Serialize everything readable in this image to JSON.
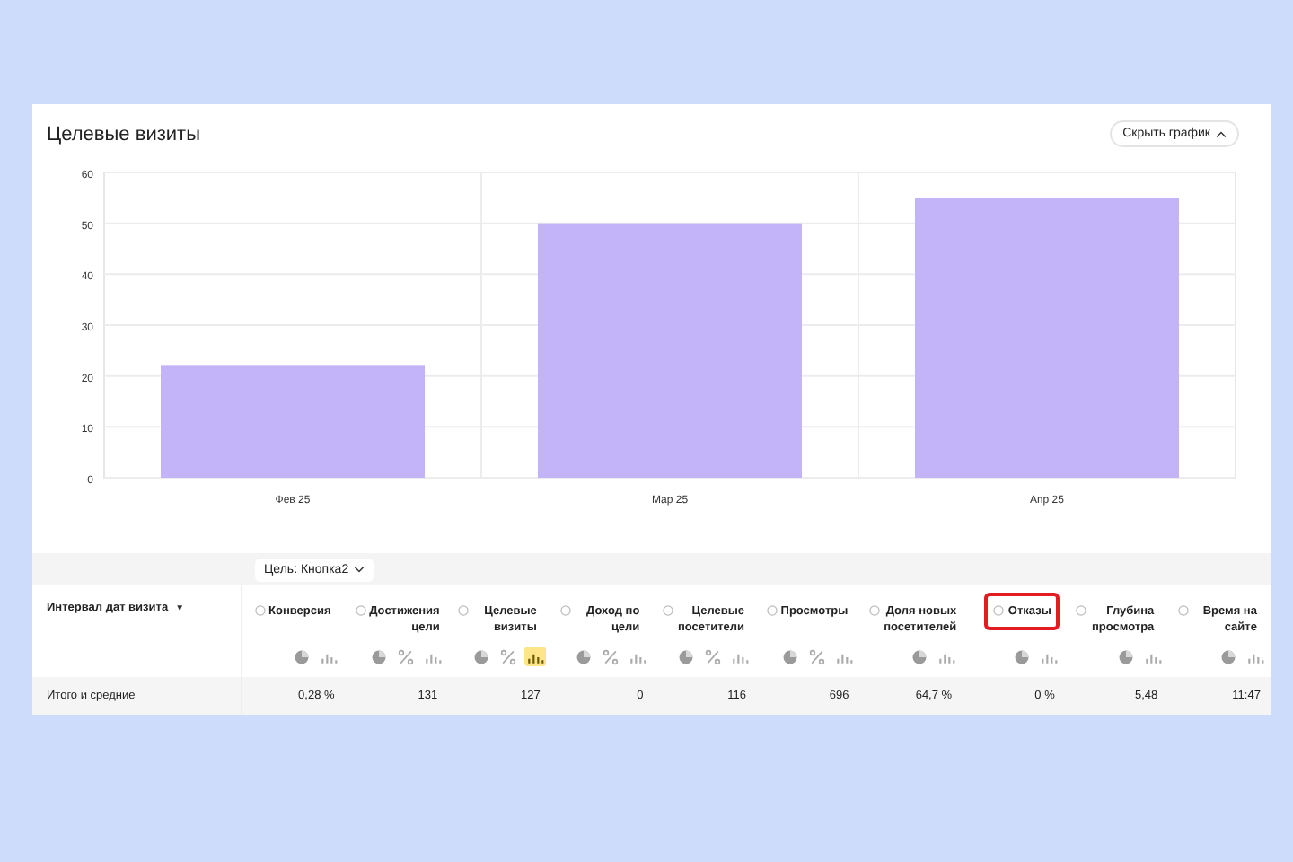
{
  "title": "Целевые визиты",
  "hide_button": {
    "label": "Скрыть график"
  },
  "chart": {
    "chart_data": {
      "type": "bar",
      "categories": [
        "Фев 25",
        "Мар 25",
        "Апр 25"
      ],
      "series": [
        {
          "color": "#c3b4fa",
          "values": [
            22,
            50,
            55
          ]
        }
      ],
      "grid": true,
      "ylim": [
        0,
        60
      ],
      "yticks": [
        0,
        10,
        20,
        30,
        40,
        50,
        60
      ]
    }
  },
  "table": {
    "goal_selector": {
      "label": "Цель: Кнопка2"
    },
    "first_column": {
      "label": "Интервал дат визита",
      "sort": "▼"
    },
    "columns": [
      {
        "label": "Конверсия",
        "highlighted": false,
        "icons": [
          {
            "kind": "pie",
            "selected": false
          },
          {
            "kind": "bars",
            "selected": false
          }
        ]
      },
      {
        "label": "Достижения цели",
        "highlighted": false,
        "icons": [
          {
            "kind": "pie",
            "selected": false
          },
          {
            "kind": "percent",
            "selected": false
          },
          {
            "kind": "bars",
            "selected": false
          }
        ]
      },
      {
        "label": "Целевые визиты",
        "highlighted": false,
        "icons": [
          {
            "kind": "pie",
            "selected": false
          },
          {
            "kind": "percent",
            "selected": false
          },
          {
            "kind": "bars",
            "selected": true
          }
        ]
      },
      {
        "label": "Доход по цели",
        "highlighted": false,
        "icons": [
          {
            "kind": "pie",
            "selected": false
          },
          {
            "kind": "percent",
            "selected": false
          },
          {
            "kind": "bars",
            "selected": false
          }
        ]
      },
      {
        "label": "Целевые посетители",
        "highlighted": false,
        "icons": [
          {
            "kind": "pie",
            "selected": false
          },
          {
            "kind": "percent",
            "selected": false
          },
          {
            "kind": "bars",
            "selected": false
          }
        ]
      },
      {
        "label": "Просмотры",
        "highlighted": false,
        "icons": [
          {
            "kind": "pie",
            "selected": false
          },
          {
            "kind": "percent",
            "selected": false
          },
          {
            "kind": "bars",
            "selected": false
          }
        ]
      },
      {
        "label": "Доля новых посетителей",
        "highlighted": false,
        "icons": [
          {
            "kind": "pie",
            "selected": false
          },
          {
            "kind": "bars",
            "selected": false
          }
        ]
      },
      {
        "label": "Отказы",
        "highlighted": true,
        "icons": [
          {
            "kind": "pie",
            "selected": false
          },
          {
            "kind": "bars",
            "selected": false
          }
        ]
      },
      {
        "label": "Глубина просмотра",
        "highlighted": false,
        "icons": [
          {
            "kind": "pie",
            "selected": false
          },
          {
            "kind": "bars",
            "selected": false
          }
        ]
      },
      {
        "label": "Время на сайте",
        "highlighted": false,
        "icons": [
          {
            "kind": "pie",
            "selected": false
          },
          {
            "kind": "bars",
            "selected": false
          }
        ]
      }
    ],
    "totals": {
      "label": "Итого и средние",
      "values": [
        "0,28 %",
        "131",
        "127",
        "0",
        "116",
        "696",
        "64,7 %",
        "0 %",
        "5,48",
        "11:47"
      ]
    }
  }
}
